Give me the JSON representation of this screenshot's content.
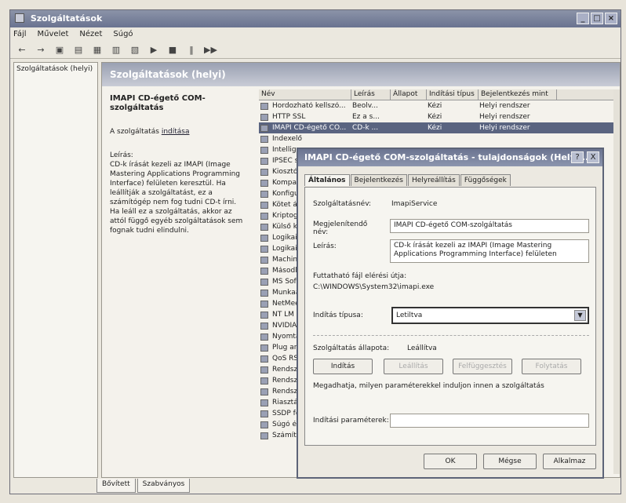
{
  "window": {
    "title": "Szolgáltatások"
  },
  "menu": [
    "Fájl",
    "Művelet",
    "Nézet",
    "Súgó"
  ],
  "tree": {
    "item": "Szolgáltatások (helyi)"
  },
  "panel": {
    "header": "Szolgáltatások (helyi)",
    "service_name": "IMAPI CD-égető COM-szolgáltatás",
    "start_text": "A szolgáltatás ",
    "start_link": "indítása",
    "desc_label": "Leírás:",
    "desc_text": "CD-k írását kezeli az IMAPI (Image Mastering Applications Programming Interface) felületen keresztül. Ha leállítják a szolgáltatást, ez a számítógép nem fog tudni CD-t írni. Ha leáll ez a szolgáltatás, akkor az attól függő egyéb szolgáltatások sem fognak tudni elindulni."
  },
  "columns": [
    "Név",
    "Leírás",
    "Állapot",
    "Indítási típus",
    "Bejelentkezés mint"
  ],
  "rows": [
    {
      "name": "Hordozható kellszó...",
      "desc": "Beolv...",
      "state": "",
      "start": "Kézi",
      "logon": "Helyi rendszer"
    },
    {
      "name": "HTTP SSL",
      "desc": "Ez a s...",
      "state": "",
      "start": "Kézi",
      "logon": "Helyi rendszer"
    },
    {
      "name": "IMAPI CD-égető CO...",
      "desc": "CD-k ...",
      "state": "",
      "start": "Kézi",
      "logon": "Helyi rendszer"
    },
    {
      "name": "Indexelő",
      "desc": "",
      "state": "",
      "start": "",
      "logon": ""
    },
    {
      "name": "Intelligens",
      "desc": "",
      "state": "",
      "start": "",
      "logon": ""
    },
    {
      "name": "IPSEC sz",
      "desc": "",
      "state": "",
      "start": "",
      "logon": ""
    },
    {
      "name": "Kiosztóp",
      "desc": "",
      "state": "",
      "start": "",
      "logon": ""
    },
    {
      "name": "Kompati",
      "desc": "",
      "state": "",
      "start": "",
      "logon": ""
    },
    {
      "name": "Konfigu",
      "desc": "",
      "state": "",
      "start": "",
      "logon": ""
    },
    {
      "name": "Kötet ár",
      "desc": "",
      "state": "",
      "start": "",
      "logon": ""
    },
    {
      "name": "Kriptogr",
      "desc": "",
      "state": "",
      "start": "",
      "logon": ""
    },
    {
      "name": "Külső ki",
      "desc": "",
      "state": "",
      "start": "",
      "logon": ""
    },
    {
      "name": "Logikai l",
      "desc": "",
      "state": "",
      "start": "",
      "logon": ""
    },
    {
      "name": "Logikai l",
      "desc": "",
      "state": "",
      "start": "",
      "logon": ""
    },
    {
      "name": "Machine",
      "desc": "",
      "state": "",
      "start": "",
      "logon": ""
    },
    {
      "name": "Másodl",
      "desc": "",
      "state": "",
      "start": "",
      "logon": ""
    },
    {
      "name": "MS Soft",
      "desc": "",
      "state": "",
      "start": "",
      "logon": ""
    },
    {
      "name": "Munkaá",
      "desc": "",
      "state": "",
      "start": "",
      "logon": ""
    },
    {
      "name": "NetMee",
      "desc": "",
      "state": "",
      "start": "",
      "logon": ""
    },
    {
      "name": "NT LM b",
      "desc": "",
      "state": "",
      "start": "",
      "logon": ""
    },
    {
      "name": "NVIDIA",
      "desc": "",
      "state": "",
      "start": "",
      "logon": ""
    },
    {
      "name": "Nyomta",
      "desc": "",
      "state": "",
      "start": "",
      "logon": ""
    },
    {
      "name": "Plug an",
      "desc": "",
      "state": "",
      "start": "",
      "logon": ""
    },
    {
      "name": "QoS RS",
      "desc": "",
      "state": "",
      "start": "",
      "logon": ""
    },
    {
      "name": "Rendsz",
      "desc": "",
      "state": "",
      "start": "",
      "logon": ""
    },
    {
      "name": "Rendsz",
      "desc": "",
      "state": "",
      "start": "",
      "logon": ""
    },
    {
      "name": "Rendsz",
      "desc": "",
      "state": "",
      "start": "",
      "logon": ""
    },
    {
      "name": "Riasztá",
      "desc": "",
      "state": "",
      "start": "",
      "logon": ""
    },
    {
      "name": "SSDP fe",
      "desc": "",
      "state": "",
      "start": "",
      "logon": ""
    },
    {
      "name": "Súgó és",
      "desc": "",
      "state": "",
      "start": "",
      "logon": ""
    },
    {
      "name": "Számító",
      "desc": "",
      "state": "",
      "start": "",
      "logon": ""
    }
  ],
  "bottom_tabs": [
    "Bővített",
    "Szabványos"
  ],
  "dialog": {
    "title": "IMAPI CD-égető COM-szolgáltatás - tulajdonságok (Helyi...",
    "help": "?",
    "close": "X",
    "tabs": [
      "Általános",
      "Bejelentkezés",
      "Helyreállítás",
      "Függőségek"
    ],
    "svc_name_label": "Szolgáltatásnév:",
    "svc_name": "ImapiService",
    "display_label": "Megjelenítendő név:",
    "display_value": "IMAPI CD-égető COM-szolgáltatás",
    "desc_label": "Leírás:",
    "desc_value": "CD-k írását kezeli az IMAPI (Image Mastering Applications Programming Interface) felületen",
    "path_label": "Futtatható fájl elérési útja:",
    "path_value": "C:\\WINDOWS\\System32\\imapi.exe",
    "startup_label": "Indítás típusa:",
    "startup_value": "Letiltva",
    "status_label": "Szolgáltatás állapota:",
    "status_value": "Leállítva",
    "btn_start": "Indítás",
    "btn_stop": "Leállítás",
    "btn_pause": "Felfüggesztés",
    "btn_resume": "Folytatás",
    "hint": "Megadhatja, milyen paraméterekkel induljon innen a szolgáltatás",
    "params_label": "Indítási paraméterek:",
    "ok": "OK",
    "cancel": "Mégse",
    "apply": "Alkalmaz"
  }
}
